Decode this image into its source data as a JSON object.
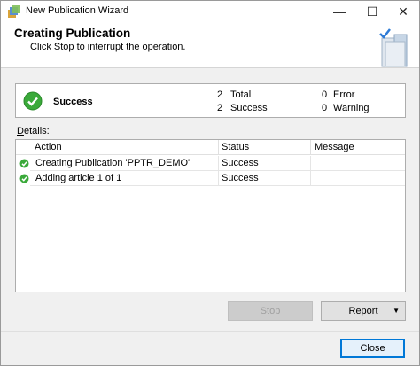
{
  "window": {
    "title": "New Publication Wizard",
    "icon": "wizard-app-icon",
    "controls": {
      "minimize": "—",
      "maximize": "☐",
      "close": "✕"
    }
  },
  "header": {
    "title": "Creating Publication",
    "subtitle": "Click Stop to interrupt the operation.",
    "graphic": "books-icon"
  },
  "status": {
    "title": "Success",
    "icon": "success-check-icon",
    "total_count": "2",
    "total_label": "Total",
    "success_count": "2",
    "success_label": "Success",
    "error_count": "0",
    "error_label": "Error",
    "warning_count": "0",
    "warning_label": "Warning",
    "accent": "#3aa93a"
  },
  "details": {
    "label_accel": "D",
    "label_rest": "etails:",
    "columns": {
      "action": "Action",
      "status": "Status",
      "message": "Message"
    },
    "rows": [
      {
        "action": "Creating Publication 'PPTR_DEMO'",
        "status": "Success",
        "message": ""
      },
      {
        "action": "Adding article 1 of 1",
        "status": "Success",
        "message": ""
      }
    ]
  },
  "buttons": {
    "stop_accel": "S",
    "stop_rest": "top",
    "report_accel": "R",
    "report_rest": "eport",
    "report_arrow": "▼",
    "close": "Close"
  }
}
